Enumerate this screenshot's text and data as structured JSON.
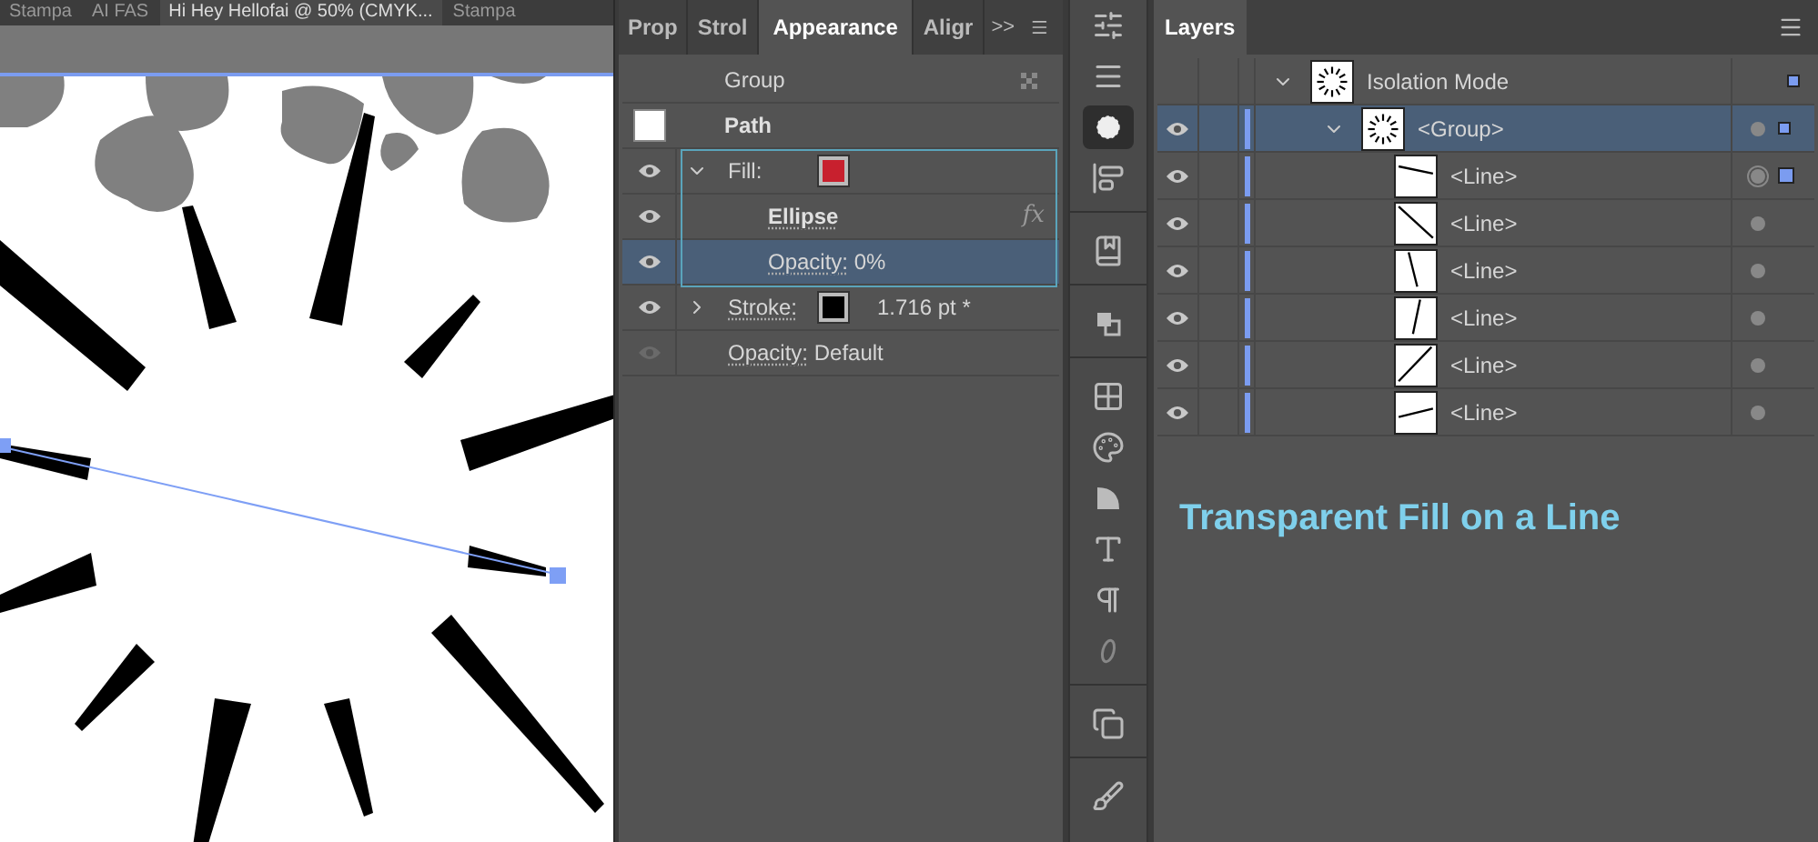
{
  "document_tabs": [
    {
      "title": "Stampa",
      "selected": false
    },
    {
      "title": "AI FAS",
      "selected": false
    },
    {
      "title": "Hi Hey Hellofai @ 50% (CMYK...",
      "selected": true
    },
    {
      "title": "Stampa",
      "selected": false
    }
  ],
  "appearance_panel": {
    "tabs": [
      {
        "label": "Prop",
        "selected": false
      },
      {
        "label": "Strol",
        "selected": false
      },
      {
        "label": "Appearance",
        "selected": true
      },
      {
        "label": "Aligr",
        "selected": false
      }
    ],
    "overflow": ">>",
    "rows": [
      {
        "kind": "group",
        "label": "Group"
      },
      {
        "kind": "path",
        "label": "Path"
      },
      {
        "kind": "fill",
        "label": "Fill:",
        "visible": true,
        "expanded": true,
        "selected": false,
        "color": "#c8202e"
      },
      {
        "kind": "effect",
        "label": "Ellipse",
        "badge": "fx",
        "visible": true,
        "selected": false
      },
      {
        "kind": "opacity",
        "label": "Opacity:",
        "value": "0%",
        "visible": true,
        "selected": true
      },
      {
        "kind": "stroke",
        "label": "Stroke:",
        "value": "1.716 pt *",
        "visible": true,
        "expanded": false,
        "selected": false,
        "color": "#000000"
      },
      {
        "kind": "opacity",
        "label": "Opacity:",
        "value": "Default",
        "visible": false,
        "selected": false
      }
    ]
  },
  "tools": [
    {
      "selected": false
    },
    {
      "selected": false
    },
    {
      "selected": true
    },
    {
      "selected": false
    },
    {
      "selected": false
    },
    {
      "selected": false
    },
    {
      "selected": false
    },
    {
      "selected": false
    },
    {
      "selected": false
    },
    {
      "selected": false
    },
    {
      "selected": false
    },
    {
      "selected": false
    },
    {
      "selected": false
    },
    {
      "selected": false
    }
  ],
  "layers_panel": {
    "title": "Layers",
    "tree": [
      {
        "name": "Isolation Mode",
        "expanded": true,
        "selected": false,
        "has_selection": true,
        "children": [
          {
            "name": "<Group>",
            "visible": true,
            "expanded": true,
            "selected": true,
            "targeted": false,
            "has_selection": true,
            "children": [
              {
                "name": "<Line>",
                "visible": true,
                "selected": false,
                "targeted": true,
                "has_selection": true
              },
              {
                "name": "<Line>",
                "visible": true,
                "selected": false,
                "targeted": false,
                "has_selection": false
              },
              {
                "name": "<Line>",
                "visible": true,
                "selected": false,
                "targeted": false,
                "has_selection": false
              },
              {
                "name": "<Line>",
                "visible": true,
                "selected": false,
                "targeted": false,
                "has_selection": false
              },
              {
                "name": "<Line>",
                "visible": true,
                "selected": false,
                "targeted": false,
                "has_selection": false
              },
              {
                "name": "<Line>",
                "visible": true,
                "selected": false,
                "targeted": false,
                "has_selection": false
              }
            ]
          }
        ]
      }
    ]
  },
  "annotation": "Transparent Fill on a Line"
}
